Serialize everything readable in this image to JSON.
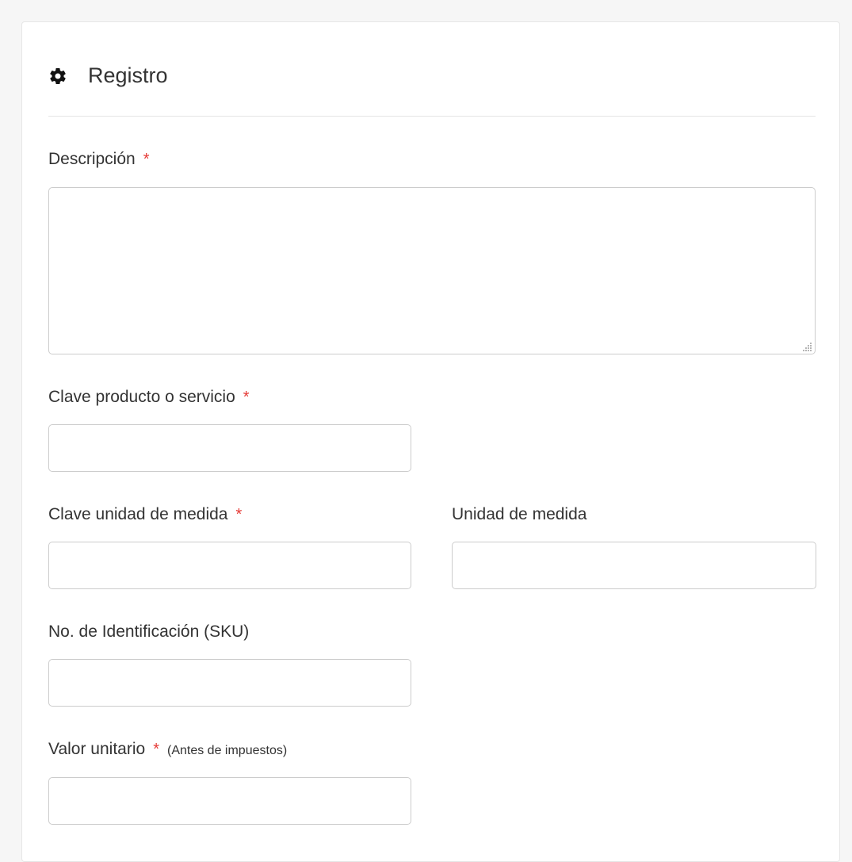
{
  "form": {
    "title": "Registro",
    "fields": {
      "descripcion": {
        "label": "Descripción",
        "required_mark": "*",
        "value": "",
        "placeholder": ""
      },
      "clave_producto": {
        "label": "Clave producto o servicio",
        "required_mark": "*",
        "value": "",
        "placeholder": ""
      },
      "clave_unidad": {
        "label": "Clave unidad de medida",
        "required_mark": "*",
        "value": "",
        "placeholder": ""
      },
      "unidad_medida": {
        "label": "Unidad de medida",
        "value": "",
        "placeholder": ""
      },
      "sku": {
        "label": "No. de Identificación (SKU)",
        "value": "",
        "placeholder": ""
      },
      "valor_unitario": {
        "label": "Valor unitario",
        "required_mark": "*",
        "hint": "(Antes de impuestos)",
        "value": "",
        "placeholder": ""
      }
    }
  },
  "icons": {
    "header": "gear-icon"
  },
  "colors": {
    "required": "#e53935",
    "text": "#333333",
    "border": "#cccccc",
    "page_background": "#f6f6f6"
  }
}
